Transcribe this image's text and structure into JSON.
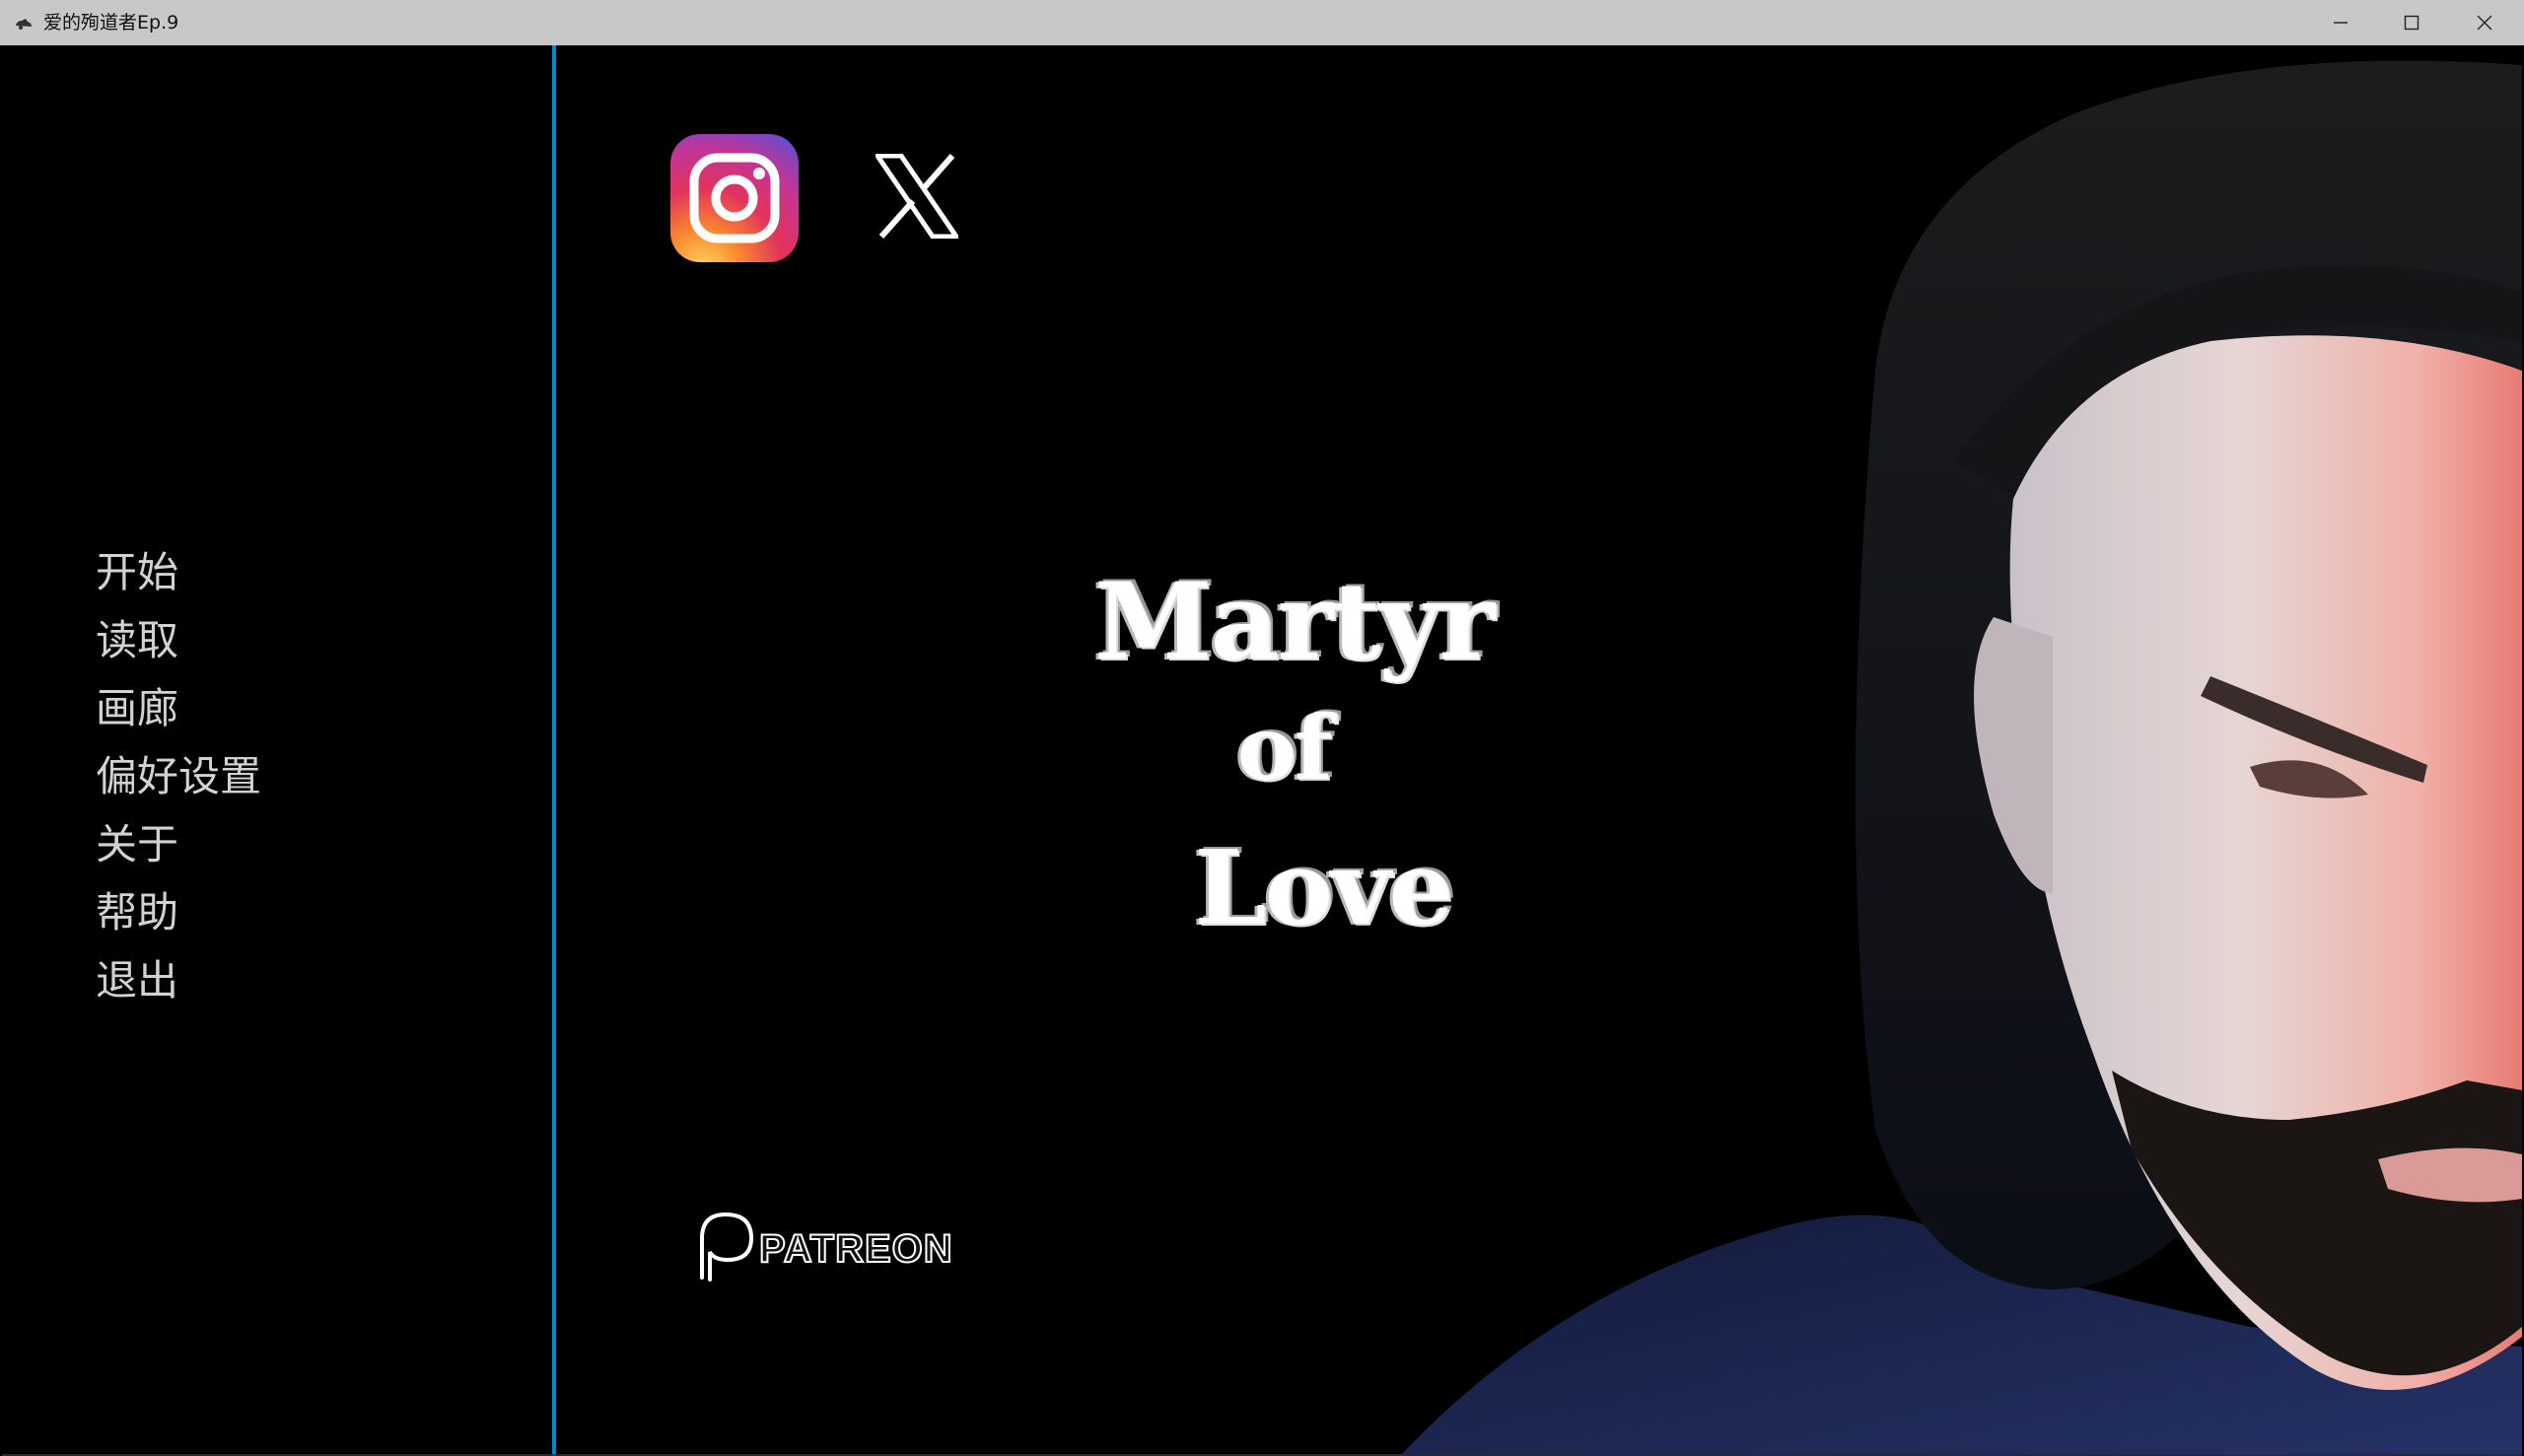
{
  "window": {
    "title": "爱的殉道者Ep.9",
    "controls": {
      "minimize": "minimize-icon",
      "maximize": "maximize-icon",
      "close": "close-icon"
    }
  },
  "main_menu": {
    "items": [
      {
        "label": "开始"
      },
      {
        "label": "读取"
      },
      {
        "label": "画廊"
      },
      {
        "label": "偏好设置"
      },
      {
        "label": "关于"
      },
      {
        "label": "帮助"
      },
      {
        "label": "退出"
      }
    ]
  },
  "social": {
    "instagram": "instagram-icon",
    "x": "x-icon"
  },
  "logo": {
    "line1": "Martyr",
    "line2": "of",
    "line3": "Love"
  },
  "patreon": {
    "label": "PATREON"
  },
  "colors": {
    "divider": "#0a86c8",
    "menu_text": "#d2d2d2",
    "titlebar": "#c8c8c8"
  }
}
